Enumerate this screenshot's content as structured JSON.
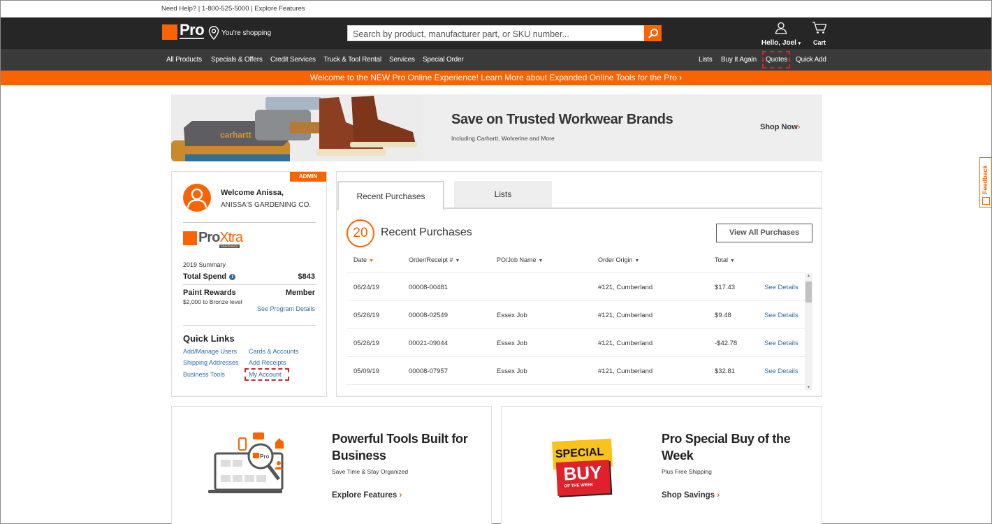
{
  "util_bar": {
    "text": "Need Help? | 1-800-525-5000 | Explore Features"
  },
  "header": {
    "logo_text": "Pro",
    "location_label": "You're shopping",
    "search_placeholder": "Search by product, manufacturer part, or SKU number...",
    "user_label": "Hello, Joel",
    "cart_label": "Cart"
  },
  "nav": {
    "left": [
      "All Products",
      "Specials & Offers",
      "Credit Services",
      "Truck & Tool Rental",
      "Services",
      "Special Order"
    ],
    "right": [
      "Lists",
      "Buy It Again",
      "Quotes",
      "Quick Add"
    ]
  },
  "promo_bar": {
    "text": "Welcome to the NEW Pro Online Experience! Learn More about Expanded Online Tools for the Pro",
    "arrow": "›"
  },
  "hero": {
    "title": "Save on Trusted Workwear Brands",
    "subtitle": "Including Carhartt, Wolverine and More",
    "cta": "Shop Now",
    "arrow": "›"
  },
  "account": {
    "badge": "ADMIN",
    "welcome": "Welcome Anissa,",
    "company": "ANISSA'S GARDENING CO.",
    "program": {
      "pro": "Pro",
      "xtra": "Xtra",
      "tier": "PREFERRED"
    },
    "summary_label": "2019 Summary",
    "total_spend_label": "Total Spend",
    "total_spend_value": "$843",
    "paint_rewards_label": "Paint Rewards",
    "paint_rewards_value": "Member",
    "paint_rewards_sub": "$2,000 to Bronze level",
    "program_details_link": "See Program Details",
    "quick_links_title": "Quick Links",
    "quick_links": [
      "Add/Manage Users",
      "Cards & Accounts",
      "Shipping Addresses",
      "Add Receipts",
      "Business Tools",
      "My Account"
    ]
  },
  "purchases": {
    "tabs": [
      "Recent Purchases",
      "Lists"
    ],
    "count": "20",
    "title": "Recent Purchases",
    "view_all": "View All Purchases",
    "columns": [
      "Date",
      "Order/Receipt #",
      "PO/Job Name",
      "Order Origin",
      "Total"
    ],
    "rows": [
      {
        "date": "06/24/19",
        "order": "00008-00481",
        "job": "",
        "origin": "#121, Cumberland",
        "total": "$17.43",
        "link": "See Details"
      },
      {
        "date": "05/26/19",
        "order": "00008-02549",
        "job": "Essex Job",
        "origin": "#121, Cumberland",
        "total": "$9.48",
        "link": "See Details"
      },
      {
        "date": "05/26/19",
        "order": "00021-09044",
        "job": "Essex Job",
        "origin": "#121, Cumberland",
        "total": "-$42.78",
        "link": "See Details"
      },
      {
        "date": "05/09/19",
        "order": "00008-07957",
        "job": "Essex Job",
        "origin": "#121, Cumberland",
        "total": "$32.81",
        "link": "See Details"
      }
    ]
  },
  "promos": [
    {
      "title": "Powerful Tools Built for Business",
      "subtitle": "Save Time & Stay Organized",
      "cta": "Explore Features",
      "arrow": "›"
    },
    {
      "title": "Pro Special Buy of the Week",
      "subtitle": "Plus Free Shipping",
      "cta": "Shop Savings",
      "arrow": "›",
      "badge_top": "SPECIAL",
      "badge_mid": "BUY",
      "badge_bottom": "OF THE WEEK"
    }
  ],
  "feedback": {
    "label": "Feedback"
  },
  "colors": {
    "brand": "#f96302",
    "link": "#2f6ea8",
    "header": "#262626",
    "nav": "#3a3a3a",
    "highlight": "#d0262d"
  }
}
